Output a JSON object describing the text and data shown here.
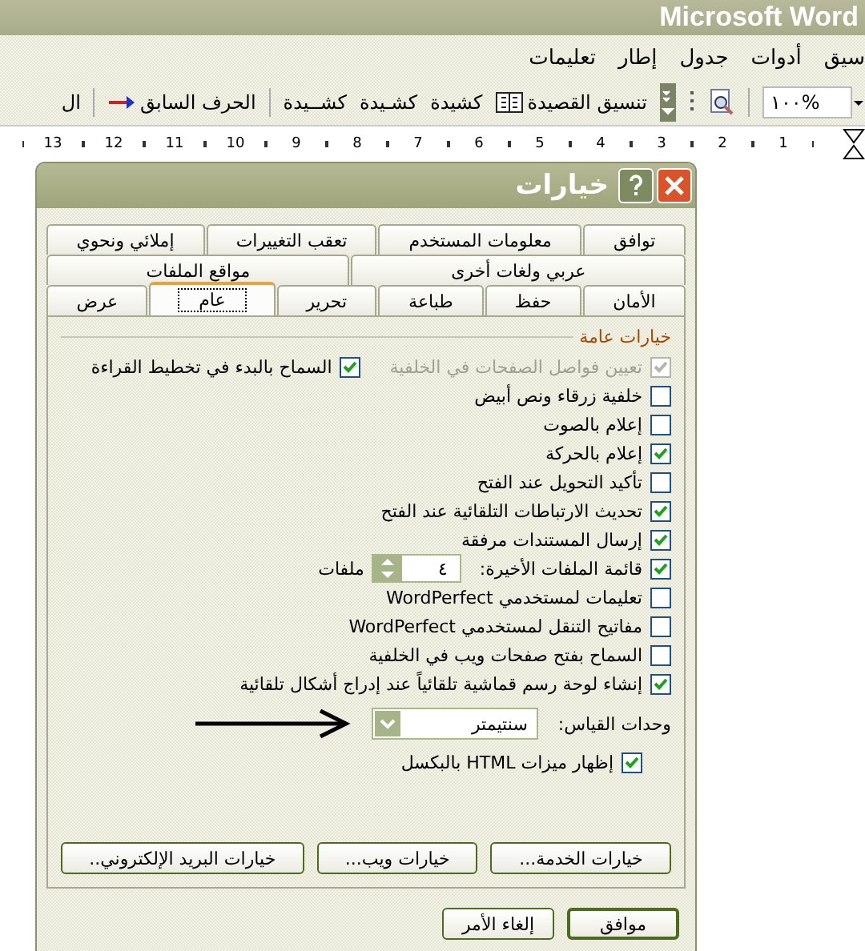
{
  "app": {
    "title": "Microsoft Word"
  },
  "menu": [
    "سيق",
    "أدوات",
    "جدول",
    "إطار",
    "تعليمات"
  ],
  "toolbar": {
    "zoom": "١٠٠%",
    "items": [
      {
        "label": "تنسيق القصيدة",
        "kind": "book"
      },
      {
        "label": "كشيدة",
        "kind": "text"
      },
      {
        "label": "كشـيدة",
        "kind": "text"
      },
      {
        "label": "كشــيدة",
        "kind": "text"
      },
      {
        "label": "الحرف السابق",
        "kind": "arrow"
      },
      {
        "label": "ال",
        "kind": "text"
      }
    ]
  },
  "ruler": [
    "1",
    "2",
    "3",
    "4",
    "5",
    "6",
    "7",
    "8",
    "9",
    "10",
    "11",
    "12",
    "13"
  ],
  "dialog": {
    "title": "خيارات",
    "tab_rows": [
      [
        {
          "label": "توافق",
          "selected": false
        },
        {
          "label": "معلومات المستخدم",
          "selected": false
        },
        {
          "label": "تعقب التغييرات",
          "selected": false
        },
        {
          "label": "إملائي ونحوي",
          "selected": false
        }
      ],
      [
        {
          "label": "عربي ولغات أخرى",
          "selected": false
        },
        {
          "label": "مواقع الملفات",
          "selected": false
        }
      ],
      [
        {
          "label": "الأمان",
          "selected": false
        },
        {
          "label": "حفظ",
          "selected": false
        },
        {
          "label": "طباعة",
          "selected": false
        },
        {
          "label": "تحرير",
          "selected": false
        },
        {
          "label": "عام",
          "selected": true
        },
        {
          "label": "عرض",
          "selected": false
        }
      ]
    ],
    "group": "خيارات عامة",
    "options": [
      {
        "label": "تعيين فواصل الصفحات في الخلفية",
        "checked": true,
        "disabled": true,
        "extra": {
          "label": "السماح بالبدء في تخطيط القراءة",
          "checked": true
        }
      },
      {
        "label": "خلفية زرقاء ونص أبيض",
        "checked": false,
        "disabled": false
      },
      {
        "label": "إعلام بالصوت",
        "checked": false,
        "disabled": false
      },
      {
        "label": "إعلام بالحركة",
        "checked": true,
        "disabled": false
      },
      {
        "label": "تأكيد التحويل عند الفتح",
        "checked": false,
        "disabled": false
      },
      {
        "label": "تحديث الارتباطات التلقائية عند الفتح",
        "checked": true,
        "disabled": false
      },
      {
        "label": "إرسال المستندات مرفقة",
        "checked": true,
        "disabled": false
      },
      {
        "label": "قائمة الملفات الأخيرة:",
        "checked": true,
        "disabled": false,
        "spinner": {
          "value": "٤",
          "unit": "ملفات"
        }
      },
      {
        "label": "تعليمات لمستخدمي WordPerfect",
        "checked": false,
        "disabled": false
      },
      {
        "label": "مفاتيح التنقل لمستخدمي WordPerfect",
        "checked": false,
        "disabled": false
      },
      {
        "label": "السماح بفتح صفحات ويب في الخلفية",
        "checked": false,
        "disabled": false
      },
      {
        "label": "إنشاء لوحة رسم قماشية تلقائياً عند إدراج أشكال تلقائية",
        "checked": true,
        "disabled": false
      }
    ],
    "units": {
      "label": "وحدات القياس:",
      "value": "سنتيمتر"
    },
    "html_option": {
      "label": "إظهار ميزات HTML بالبكسل",
      "checked": true
    },
    "panel_buttons": [
      "خيارات الخدمة...",
      "خيارات ويب...",
      "خيارات البريد الإلكتروني.."
    ],
    "buttons": [
      "موافق",
      "إلغاء الأمر"
    ]
  }
}
